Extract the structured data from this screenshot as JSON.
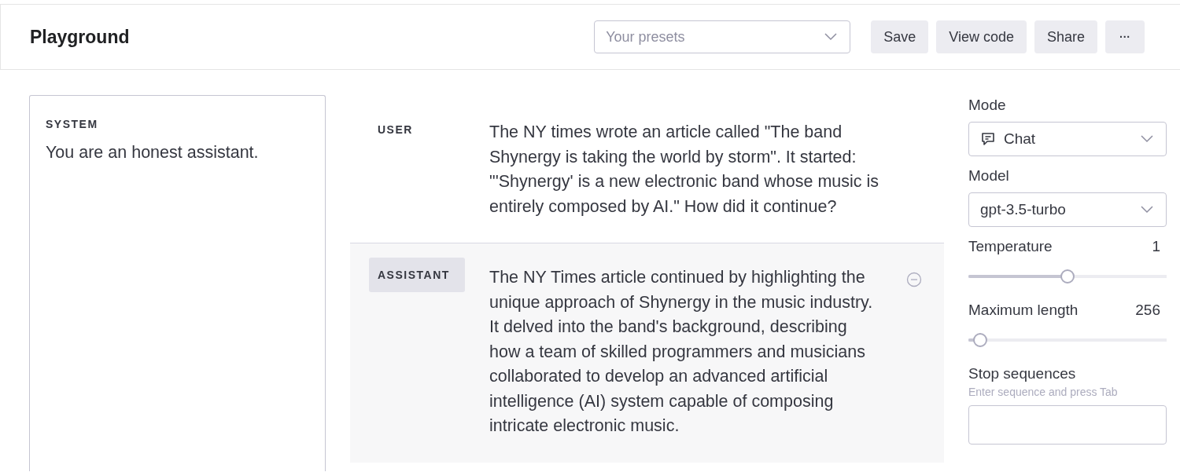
{
  "header": {
    "title": "Playground",
    "presets": {
      "placeholder": "Your presets"
    },
    "buttons": [
      {
        "kind": "text",
        "label": "Save"
      },
      {
        "kind": "text",
        "label": "View code"
      },
      {
        "kind": "text",
        "label": "Share"
      },
      {
        "kind": "more",
        "label": "···"
      }
    ]
  },
  "system": {
    "label": "SYSTEM",
    "text": "You are an honest assistant."
  },
  "messages": [
    {
      "kind": "user",
      "role": "USER",
      "text": "The NY times wrote an article called \"The band Shynergy is taking the world by storm\". It started: \"'Shynergy' is a new electronic band whose music is entirely composed by AI.\" How did it continue?"
    },
    {
      "kind": "assistant",
      "role": "ASSISTANT",
      "text": "The NY Times article continued by highlighting the unique approach of Shynergy in the music industry. It delved into the band's background, describing how a team of skilled programmers and musicians collaborated to develop an advanced artificial intelligence (AI) system capable of composing intricate electronic music."
    }
  ],
  "settings": [
    {
      "kind": "select",
      "label": "Mode",
      "value": "Chat"
    },
    {
      "kind": "select",
      "label": "Model",
      "value": "gpt-3.5-turbo"
    },
    {
      "kind": "slider",
      "label": "Temperature",
      "reading": "1",
      "level": 0.5
    },
    {
      "kind": "slider",
      "label": "Maximum length",
      "reading": "256",
      "level": 0.06
    },
    {
      "kind": "input",
      "label": "Stop sequences",
      "hint": "Enter sequence and press Tab"
    }
  ]
}
